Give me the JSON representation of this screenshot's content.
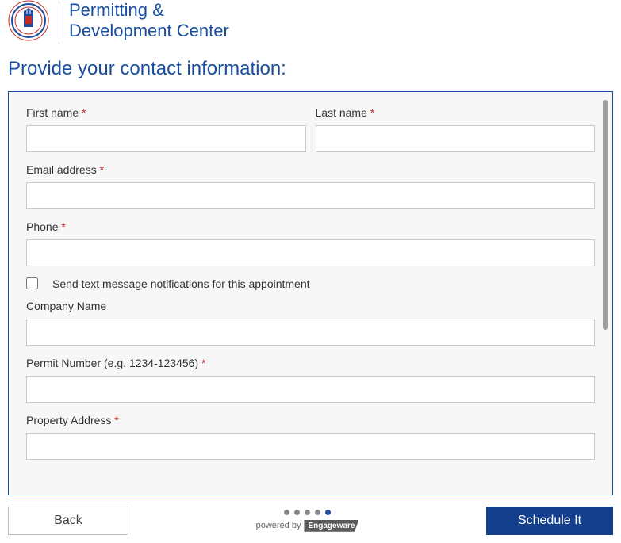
{
  "header": {
    "brand_line1": "Permitting &",
    "brand_line2": "Development Center"
  },
  "page": {
    "title": "Provide your contact information:"
  },
  "fields": {
    "first_name_label": "First name",
    "last_name_label": "Last name",
    "email_label": "Email address",
    "phone_label": "Phone",
    "sms_checkbox_label": "Send text message notifications for this appointment",
    "company_label": "Company Name",
    "permit_label": "Permit Number (e.g. 1234-123456)",
    "property_label": "Property Address",
    "required_mark": "*",
    "first_name_value": "",
    "last_name_value": "",
    "email_value": "",
    "phone_value": "",
    "company_value": "",
    "permit_value": "",
    "property_value": ""
  },
  "footer": {
    "back_label": "Back",
    "submit_label": "Schedule It",
    "powered_by_text": "powered by",
    "powered_by_brand": "Engageware"
  }
}
